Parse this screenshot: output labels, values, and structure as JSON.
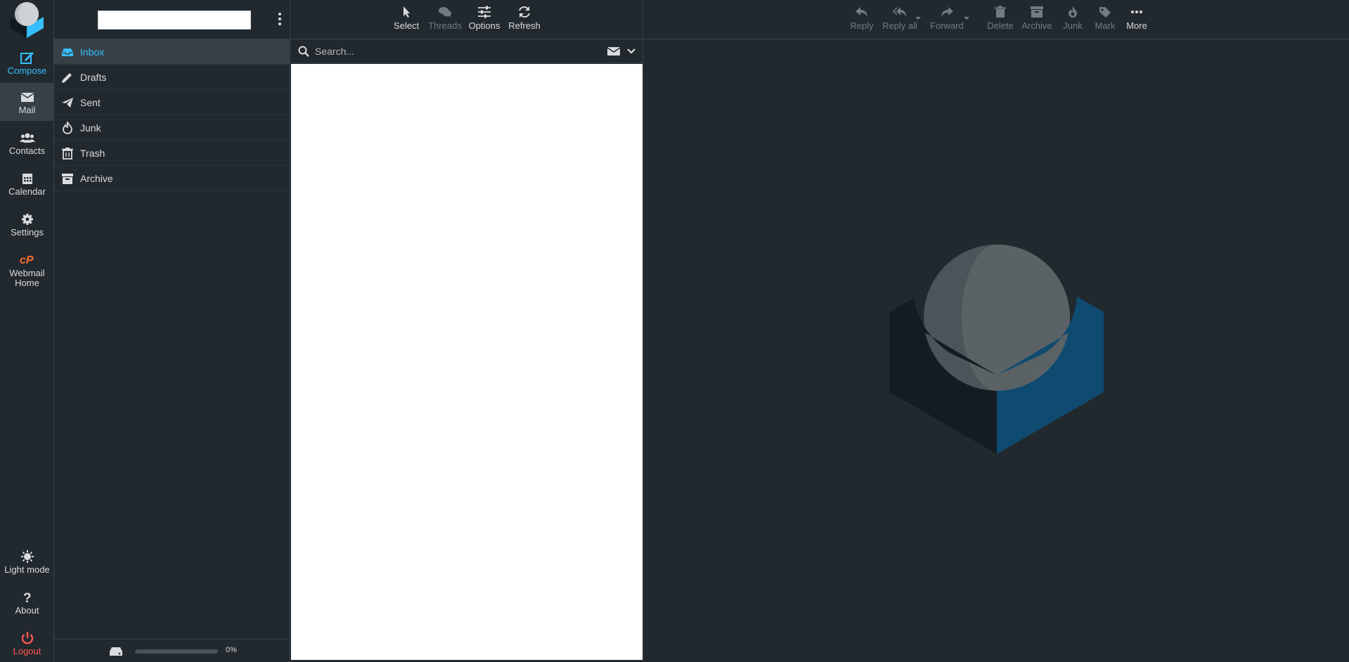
{
  "nav": {
    "items": [
      {
        "label": "Compose",
        "icon": "compose-icon"
      },
      {
        "label": "Mail",
        "icon": "envelope-icon"
      },
      {
        "label": "Contacts",
        "icon": "users-icon"
      },
      {
        "label": "Calendar",
        "icon": "calendar-icon"
      },
      {
        "label": "Settings",
        "icon": "gear-icon"
      },
      {
        "label": "Webmail Home",
        "icon": "cpanel-icon"
      }
    ],
    "bottom": [
      {
        "label": "Light mode",
        "icon": "light-mode-icon"
      },
      {
        "label": "About",
        "icon": "question-icon"
      },
      {
        "label": "Logout",
        "icon": "power-icon"
      }
    ]
  },
  "folders": {
    "items": [
      {
        "label": "Inbox",
        "icon": "inbox-icon"
      },
      {
        "label": "Drafts",
        "icon": "pencil-icon"
      },
      {
        "label": "Sent",
        "icon": "paper-plane-icon"
      },
      {
        "label": "Junk",
        "icon": "fire-icon"
      },
      {
        "label": "Trash",
        "icon": "trash-icon"
      },
      {
        "label": "Archive",
        "icon": "archive-icon"
      }
    ],
    "quota": {
      "text": "0%",
      "percent": 0
    }
  },
  "list_toolbar": {
    "select": "Select",
    "threads": "Threads",
    "options": "Options",
    "refresh": "Refresh"
  },
  "search": {
    "placeholder": "Search..."
  },
  "message_toolbar": {
    "reply": "Reply",
    "reply_all": "Reply all",
    "forward": "Forward",
    "delete": "Delete",
    "archive": "Archive",
    "junk": "Junk",
    "mark": "Mark",
    "more": "More"
  },
  "colors": {
    "background": "#22292e",
    "accent": "#37beff",
    "logout": "#ff5552",
    "cpanel": "#ff6c2c",
    "disabled": "#737b80"
  }
}
